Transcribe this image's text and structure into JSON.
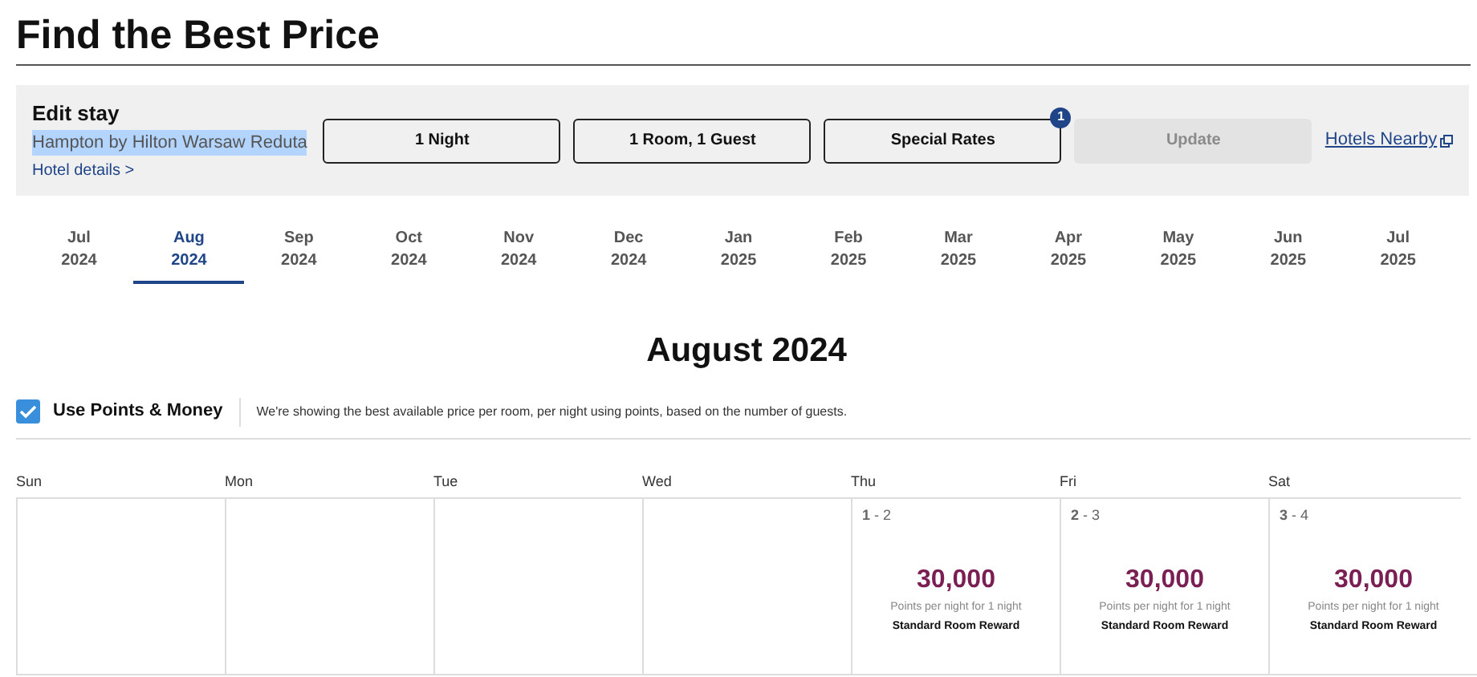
{
  "title": "Find the Best Price",
  "edit_stay": {
    "heading": "Edit stay",
    "hotel_name": "Hampton by Hilton Warsaw Reduta",
    "hotel_name_highlighted": true,
    "hotel_details_link": "Hotel details >",
    "buttons": [
      {
        "label": "1 Night"
      },
      {
        "label": "1 Room, 1 Guest"
      },
      {
        "label": "Special Rates",
        "badge": "1"
      }
    ],
    "update_button": {
      "label": "Update",
      "disabled": true
    },
    "nearby_link": "Hotels Nearby"
  },
  "months": [
    {
      "month": "Jul",
      "year": "2024",
      "selected": false
    },
    {
      "month": "Aug",
      "year": "2024",
      "selected": true
    },
    {
      "month": "Sep",
      "year": "2024",
      "selected": false
    },
    {
      "month": "Oct",
      "year": "2024",
      "selected": false
    },
    {
      "month": "Nov",
      "year": "2024",
      "selected": false
    },
    {
      "month": "Dec",
      "year": "2024",
      "selected": false
    },
    {
      "month": "Jan",
      "year": "2025",
      "selected": false
    },
    {
      "month": "Feb",
      "year": "2025",
      "selected": false
    },
    {
      "month": "Mar",
      "year": "2025",
      "selected": false
    },
    {
      "month": "Apr",
      "year": "2025",
      "selected": false
    },
    {
      "month": "May",
      "year": "2025",
      "selected": false
    },
    {
      "month": "Jun",
      "year": "2025",
      "selected": false
    },
    {
      "month": "Jul",
      "year": "2025",
      "selected": false
    }
  ],
  "calendar_title": "August 2024",
  "points_toggle": {
    "label": "Use Points & Money",
    "checked": true,
    "note": "We're showing the best available price per room, per night using points, based on the number of guests."
  },
  "weekdays": [
    "Sun",
    "Mon",
    "Tue",
    "Wed",
    "Thu",
    "Fri",
    "Sat"
  ],
  "days": [
    {
      "kind": "empty"
    },
    {
      "kind": "empty"
    },
    {
      "kind": "empty"
    },
    {
      "kind": "empty"
    },
    {
      "kind": "price",
      "dates": "**1** - 2",
      "price": "30,000",
      "caption": "Points per night for 1 night",
      "rate": "Standard Room Reward"
    },
    {
      "kind": "price",
      "dates": "**2** - 3",
      "price": "30,000",
      "caption": "Points per night for 1 night",
      "rate": "Standard Room Reward"
    },
    {
      "kind": "price",
      "dates": "**3** - 4",
      "price": "30,000",
      "caption": "Points per night for 1 night",
      "rate": "Standard Room Reward"
    }
  ]
}
